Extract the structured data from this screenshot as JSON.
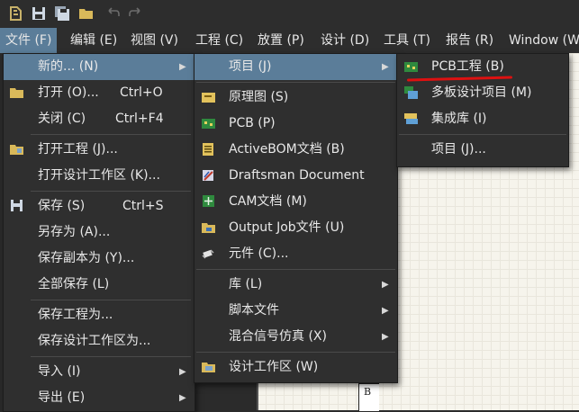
{
  "menubar": {
    "items": [
      "文件 (F)",
      "编辑 (E)",
      "视图 (V)",
      "工程 (C)",
      "放置 (P)",
      "设计 (D)",
      "工具 (T)",
      "报告 (R)",
      "Window (W"
    ]
  },
  "file_menu": {
    "new": "新的... (N)",
    "open": "打开 (O)...",
    "open_shortcut": "Ctrl+O",
    "close": "关闭 (C)",
    "close_shortcut": "Ctrl+F4",
    "open_project": "打开工程 (J)...",
    "open_workspace": "打开设计工作区 (K)...",
    "save": "保存 (S)",
    "save_shortcut": "Ctrl+S",
    "save_as": "另存为 (A)...",
    "save_copy_as": "保存副本为 (Y)...",
    "save_all": "全部保存 (L)",
    "save_project_as": "保存工程为...",
    "save_workspace_as": "保存设计工作区为...",
    "import": "导入 (I)",
    "export": "导出 (E)"
  },
  "new_menu": {
    "project": "项目 (J)",
    "schematic": "原理图 (S)",
    "pcb": "PCB (P)",
    "activebom": "ActiveBOM文档 (B)",
    "draftsman": "Draftsman Document",
    "cam": "CAM文档 (M)",
    "output_job": "Output Job文件 (U)",
    "component": "元件 (C)...",
    "library": "库 (L)",
    "script": "脚本文件",
    "mixed_sim": "混合信号仿真 (X)",
    "workspace": "设计工作区 (W)"
  },
  "project_menu": {
    "pcb_project": "PCB工程 (B)",
    "multiboard": "多板设计项目 (M)",
    "integrated_lib": "集成库 (I)",
    "project": "项目 (J)..."
  },
  "canvas": {
    "sheet_letter": "B"
  }
}
